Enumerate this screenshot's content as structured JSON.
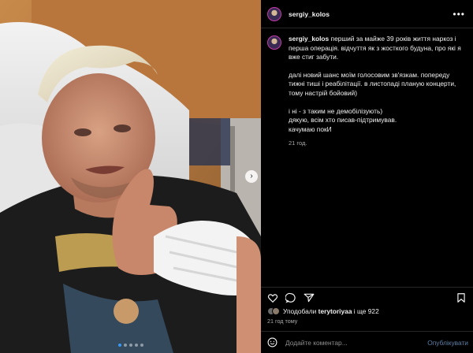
{
  "post": {
    "username": "sergiy_kolos",
    "more_icon": "ellipsis-icon",
    "photo_alt": "Man with bleached hair lying in hospital bed giving thumbs up, bandaged hand",
    "carousel": {
      "count": 5,
      "active": 0
    }
  },
  "caption": {
    "username": "sergiy_kolos",
    "paragraphs": [
      "перший за майже 39 років життя наркоз і перша операція. відчуття як з жосткого будуна, про які я вже стиг забути.",
      "далі новий шанс моїм голосовим зв'язкам. попереду тижні тиші і реабілітації. в листопаді планую концерти, тому настрій бойовий)",
      "і ні - з таким не демобілізують)\nдякую, всім хто писав-підтримував.\nкачумаю покИ"
    ],
    "time": "21 год."
  },
  "actions": {
    "icons": [
      "heart-icon",
      "comment-icon",
      "share-icon",
      "bookmark-icon"
    ]
  },
  "likes": {
    "prefix": "Уподобали ",
    "user": "terytoriyaa",
    "suffix": " і ще 922"
  },
  "post_time": "21 год тому",
  "comment": {
    "placeholder": "Додайте коментар...",
    "publish": "Опублікувати"
  },
  "colors": {
    "background": "#000000",
    "text": "#f5f5f5",
    "muted": "#a8a8a8",
    "link": "#5a7fa6",
    "active_dot": "#3897f0",
    "divider": "#262626"
  }
}
